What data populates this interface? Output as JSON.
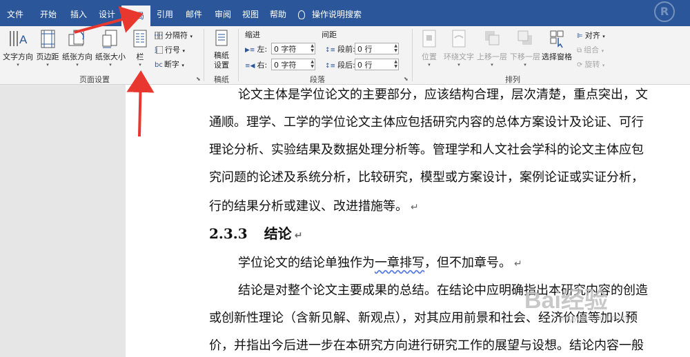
{
  "tabs": [
    "文件",
    "开始",
    "插入",
    "设计",
    "布局",
    "引用",
    "邮件",
    "审阅",
    "视图",
    "帮助"
  ],
  "active_tab": "布局",
  "tell_me": "操作说明搜索",
  "ribbon": {
    "page_setup": {
      "group_label": "页面设置",
      "text_direction": "文字方向",
      "margins": "页边距",
      "orientation": "纸张方向",
      "size": "纸张大小",
      "columns": "栏",
      "breaks": "分隔符",
      "line_numbers": "行号",
      "hyphenation": "断字"
    },
    "manuscript": {
      "group_label": "稿纸",
      "button": "稿纸设置"
    },
    "paragraph": {
      "group_label": "段落",
      "indent_header": "缩进",
      "spacing_header": "间距",
      "left_label": "左:",
      "left_value": "0 字符",
      "right_label": "右:",
      "right_value": "0 字符",
      "before_label": "段前:",
      "before_value": "0 行",
      "after_label": "段后:",
      "after_value": "0 行"
    },
    "arrange": {
      "group_label": "排列",
      "position": "位置",
      "wrap_text": "环绕文字",
      "bring_forward": "上移一层",
      "send_backward": "下移一层",
      "selection_pane": "选择窗格",
      "align": "对齐",
      "group": "组合",
      "rotate": "旋转"
    }
  },
  "document": {
    "line1": "论文主体是学位论文的主要部分，应该结构合理，层次清楚，重点突出，文",
    "line2": "通顺。理学、工学的学位论文主体应包括研究内容的总体方案设计及论证、可行",
    "line3": "理论分析、实验结果及数据处理分析等。管理学和人文社会学科的论文主体应包",
    "line4": "究问题的论述及系统分析，比较研究，模型或方案设计，案例论证或实证分析，",
    "line5": "行的结果分析或建议、改进措施等。",
    "heading_number": "2.3.3",
    "heading_text": "结论",
    "para2_a": "学位论文的结论单独作为",
    "para2_b": "一章排写",
    "para2_c": "，但不加章号。",
    "para3_line1": "结论是对整个论文主要成果的总结。在结论中应明确指出本研究内容的创造",
    "para3_line2": "或创新性理论（含新见解、新观点），对其应用前景和社会、经济价值等加以预",
    "para3_line3": "价，并指出今后进一步在本研究方向进行研究工作的展望与设想。结论内容一般",
    "para_mark": "↵"
  },
  "watermark": {
    "brand": "Bai经验",
    "url": "jingyan.baidu.com"
  },
  "colors": {
    "tabbar": "#2b579a",
    "ribbon": "#f3f3f3",
    "arrow": "#e8372f"
  }
}
